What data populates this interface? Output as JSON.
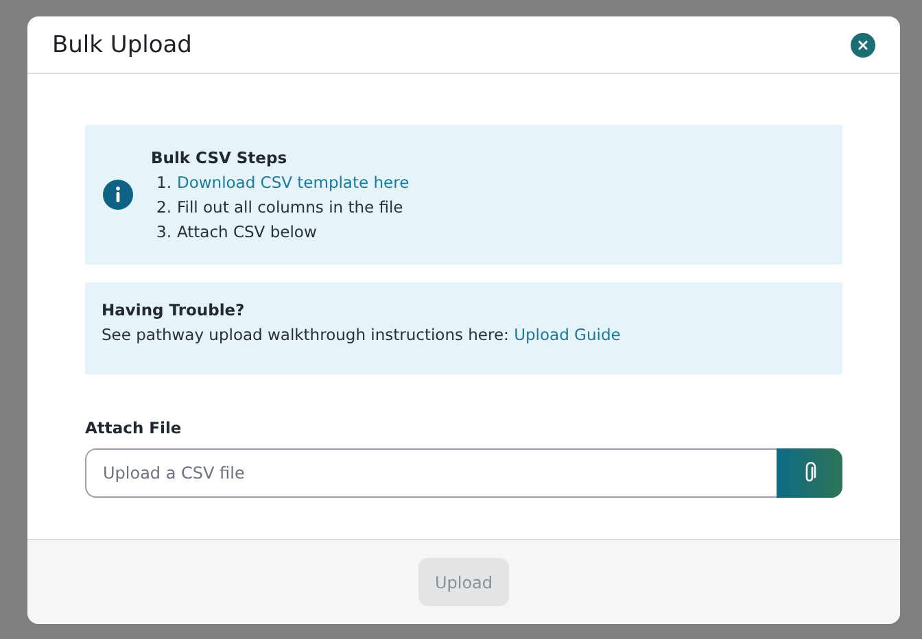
{
  "dialog": {
    "title": "Bulk Upload"
  },
  "steps_box": {
    "heading": "Bulk CSV Steps",
    "steps": [
      {
        "number": "1.",
        "text": "Download CSV template here",
        "kind": "link"
      },
      {
        "number": "2.",
        "text": "Fill out all columns in the file",
        "kind": "text"
      },
      {
        "number": "3.",
        "text": "Attach CSV below",
        "kind": "text"
      }
    ]
  },
  "help_box": {
    "heading": "Having Trouble?",
    "text": "See pathway upload walkthrough instructions here:",
    "link": "Upload Guide"
  },
  "attach": {
    "label": "Attach File",
    "placeholder": "Upload a CSV file"
  },
  "footer": {
    "button": {
      "label": "Upload",
      "disabled": true
    }
  }
}
